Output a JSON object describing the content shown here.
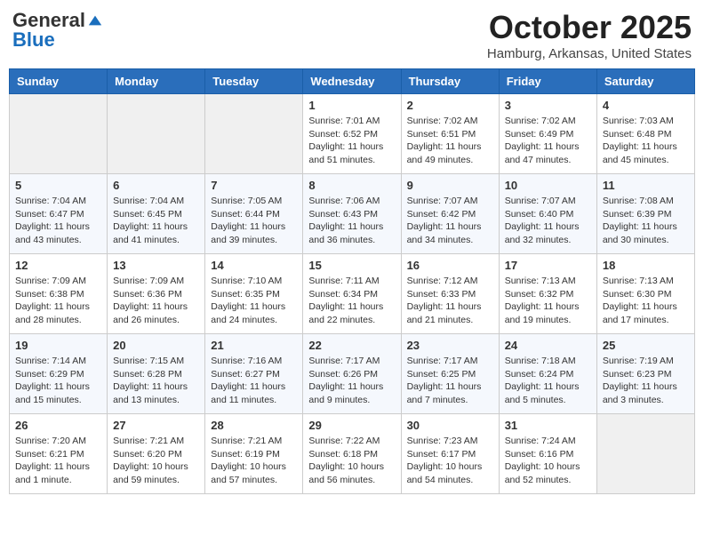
{
  "logo": {
    "general": "General",
    "blue": "Blue"
  },
  "title": "October 2025",
  "location": "Hamburg, Arkansas, United States",
  "days_of_week": [
    "Sunday",
    "Monday",
    "Tuesday",
    "Wednesday",
    "Thursday",
    "Friday",
    "Saturday"
  ],
  "weeks": [
    [
      {
        "day": "",
        "info": ""
      },
      {
        "day": "",
        "info": ""
      },
      {
        "day": "",
        "info": ""
      },
      {
        "day": "1",
        "info": "Sunrise: 7:01 AM\nSunset: 6:52 PM\nDaylight: 11 hours\nand 51 minutes."
      },
      {
        "day": "2",
        "info": "Sunrise: 7:02 AM\nSunset: 6:51 PM\nDaylight: 11 hours\nand 49 minutes."
      },
      {
        "day": "3",
        "info": "Sunrise: 7:02 AM\nSunset: 6:49 PM\nDaylight: 11 hours\nand 47 minutes."
      },
      {
        "day": "4",
        "info": "Sunrise: 7:03 AM\nSunset: 6:48 PM\nDaylight: 11 hours\nand 45 minutes."
      }
    ],
    [
      {
        "day": "5",
        "info": "Sunrise: 7:04 AM\nSunset: 6:47 PM\nDaylight: 11 hours\nand 43 minutes."
      },
      {
        "day": "6",
        "info": "Sunrise: 7:04 AM\nSunset: 6:45 PM\nDaylight: 11 hours\nand 41 minutes."
      },
      {
        "day": "7",
        "info": "Sunrise: 7:05 AM\nSunset: 6:44 PM\nDaylight: 11 hours\nand 39 minutes."
      },
      {
        "day": "8",
        "info": "Sunrise: 7:06 AM\nSunset: 6:43 PM\nDaylight: 11 hours\nand 36 minutes."
      },
      {
        "day": "9",
        "info": "Sunrise: 7:07 AM\nSunset: 6:42 PM\nDaylight: 11 hours\nand 34 minutes."
      },
      {
        "day": "10",
        "info": "Sunrise: 7:07 AM\nSunset: 6:40 PM\nDaylight: 11 hours\nand 32 minutes."
      },
      {
        "day": "11",
        "info": "Sunrise: 7:08 AM\nSunset: 6:39 PM\nDaylight: 11 hours\nand 30 minutes."
      }
    ],
    [
      {
        "day": "12",
        "info": "Sunrise: 7:09 AM\nSunset: 6:38 PM\nDaylight: 11 hours\nand 28 minutes."
      },
      {
        "day": "13",
        "info": "Sunrise: 7:09 AM\nSunset: 6:36 PM\nDaylight: 11 hours\nand 26 minutes."
      },
      {
        "day": "14",
        "info": "Sunrise: 7:10 AM\nSunset: 6:35 PM\nDaylight: 11 hours\nand 24 minutes."
      },
      {
        "day": "15",
        "info": "Sunrise: 7:11 AM\nSunset: 6:34 PM\nDaylight: 11 hours\nand 22 minutes."
      },
      {
        "day": "16",
        "info": "Sunrise: 7:12 AM\nSunset: 6:33 PM\nDaylight: 11 hours\nand 21 minutes."
      },
      {
        "day": "17",
        "info": "Sunrise: 7:13 AM\nSunset: 6:32 PM\nDaylight: 11 hours\nand 19 minutes."
      },
      {
        "day": "18",
        "info": "Sunrise: 7:13 AM\nSunset: 6:30 PM\nDaylight: 11 hours\nand 17 minutes."
      }
    ],
    [
      {
        "day": "19",
        "info": "Sunrise: 7:14 AM\nSunset: 6:29 PM\nDaylight: 11 hours\nand 15 minutes."
      },
      {
        "day": "20",
        "info": "Sunrise: 7:15 AM\nSunset: 6:28 PM\nDaylight: 11 hours\nand 13 minutes."
      },
      {
        "day": "21",
        "info": "Sunrise: 7:16 AM\nSunset: 6:27 PM\nDaylight: 11 hours\nand 11 minutes."
      },
      {
        "day": "22",
        "info": "Sunrise: 7:17 AM\nSunset: 6:26 PM\nDaylight: 11 hours\nand 9 minutes."
      },
      {
        "day": "23",
        "info": "Sunrise: 7:17 AM\nSunset: 6:25 PM\nDaylight: 11 hours\nand 7 minutes."
      },
      {
        "day": "24",
        "info": "Sunrise: 7:18 AM\nSunset: 6:24 PM\nDaylight: 11 hours\nand 5 minutes."
      },
      {
        "day": "25",
        "info": "Sunrise: 7:19 AM\nSunset: 6:23 PM\nDaylight: 11 hours\nand 3 minutes."
      }
    ],
    [
      {
        "day": "26",
        "info": "Sunrise: 7:20 AM\nSunset: 6:21 PM\nDaylight: 11 hours\nand 1 minute."
      },
      {
        "day": "27",
        "info": "Sunrise: 7:21 AM\nSunset: 6:20 PM\nDaylight: 10 hours\nand 59 minutes."
      },
      {
        "day": "28",
        "info": "Sunrise: 7:21 AM\nSunset: 6:19 PM\nDaylight: 10 hours\nand 57 minutes."
      },
      {
        "day": "29",
        "info": "Sunrise: 7:22 AM\nSunset: 6:18 PM\nDaylight: 10 hours\nand 56 minutes."
      },
      {
        "day": "30",
        "info": "Sunrise: 7:23 AM\nSunset: 6:17 PM\nDaylight: 10 hours\nand 54 minutes."
      },
      {
        "day": "31",
        "info": "Sunrise: 7:24 AM\nSunset: 6:16 PM\nDaylight: 10 hours\nand 52 minutes."
      },
      {
        "day": "",
        "info": ""
      }
    ]
  ]
}
